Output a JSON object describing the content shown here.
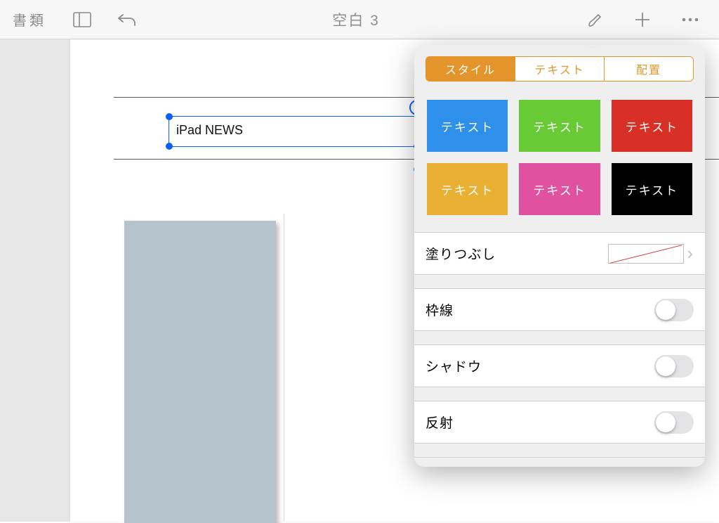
{
  "toolbar": {
    "documents_label": "書類",
    "title": "空白 3"
  },
  "canvas": {
    "textbox_value": "iPad NEWS"
  },
  "format_panel": {
    "tabs": {
      "style": "スタイル",
      "text": "テキスト",
      "arrange": "配置"
    },
    "swatch_label": "テキスト",
    "swatch_colors": {
      "blue": "#2e90ea",
      "green": "#68cb36",
      "red": "#d83027",
      "yellow": "#eab033",
      "pink": "#e052a0",
      "black": "#000000"
    },
    "rows": {
      "fill": "塗りつぶし",
      "border": "枠線",
      "shadow": "シャドウ",
      "reflection": "反射"
    },
    "toggles": {
      "border": false,
      "shadow": false,
      "reflection": false
    }
  }
}
